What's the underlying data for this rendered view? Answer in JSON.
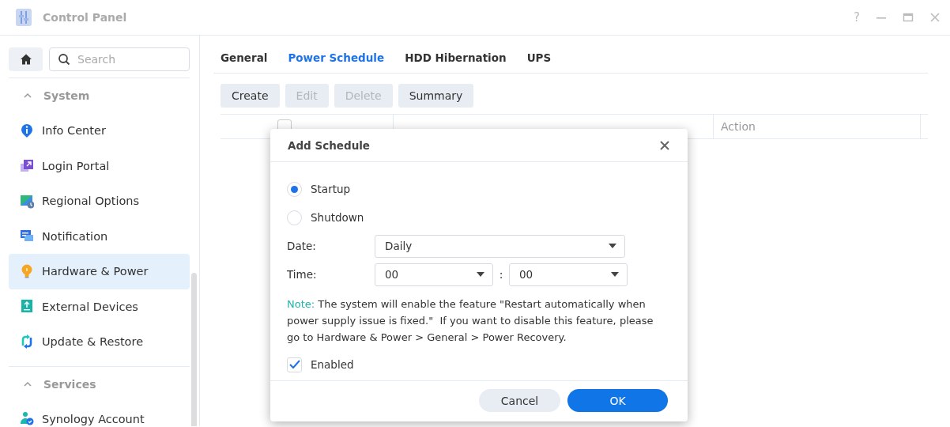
{
  "window": {
    "title": "Control Panel",
    "controls": [
      {
        "kind": "help",
        "label": "?"
      },
      {
        "kind": "minimize"
      },
      {
        "kind": "maximize"
      },
      {
        "kind": "close"
      }
    ]
  },
  "sidebar": {
    "search": {
      "placeholder": "Search"
    },
    "sections": [
      {
        "title": "System",
        "expanded": true,
        "items": [
          {
            "label": "Info Center",
            "kind": "info",
            "selected": false
          },
          {
            "label": "Login Portal",
            "kind": "portal",
            "selected": false
          },
          {
            "label": "Regional Options",
            "kind": "regional",
            "selected": false
          },
          {
            "label": "Notification",
            "kind": "notification",
            "selected": false
          },
          {
            "label": "Hardware & Power",
            "kind": "bulb",
            "selected": true
          },
          {
            "label": "External Devices",
            "kind": "external",
            "selected": false
          },
          {
            "label": "Update & Restore",
            "kind": "update",
            "selected": false
          }
        ]
      },
      {
        "title": "Services",
        "expanded": true,
        "items": [
          {
            "label": "Synology Account",
            "kind": "account",
            "selected": false
          }
        ]
      }
    ]
  },
  "tabs": [
    {
      "label": "General",
      "selected": false
    },
    {
      "label": "Power Schedule",
      "selected": true
    },
    {
      "label": "HDD Hibernation",
      "selected": false
    },
    {
      "label": "UPS",
      "selected": false
    }
  ],
  "toolbar": [
    {
      "label": "Create",
      "disabled": false
    },
    {
      "label": "Edit",
      "disabled": true
    },
    {
      "label": "Delete",
      "disabled": true
    },
    {
      "label": "Summary",
      "disabled": false
    }
  ],
  "table": {
    "select_all": {
      "checked": false
    },
    "columns": [
      {
        "label": "Action"
      }
    ]
  },
  "dialog": {
    "title": "Add Schedule",
    "options": [
      {
        "label": "Startup",
        "selected": true
      },
      {
        "label": "Shutdown",
        "selected": false
      }
    ],
    "date": {
      "label": "Date:",
      "value": "Daily"
    },
    "time": {
      "label": "Time:",
      "hour": "00",
      "separator": ":",
      "minute": "00"
    },
    "note_label": "Note:",
    "note_text": "The system will enable the feature \"Restart automatically when power supply issue is fixed.\"  If you want to disable this feature, please go to Hardware & Power > General > Power Recovery.",
    "enabled": {
      "label": "Enabled",
      "checked": true
    },
    "buttons": [
      {
        "label": "Cancel",
        "kind": "secondary"
      },
      {
        "label": "OK",
        "kind": "primary"
      }
    ]
  }
}
